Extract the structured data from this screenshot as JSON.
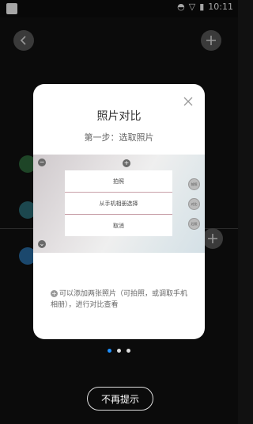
{
  "status_bar": {
    "time": "10:11"
  },
  "dialog": {
    "title": "照片对比",
    "subtitle": "第一步：选取照片",
    "preview_menu": [
      "拍照",
      "从手机相册选择",
      "取消"
    ],
    "preview_side_labels": [
      "前照",
      "对比",
      "后照"
    ],
    "hint": "可以添加两张照片（可拍照，或调取手机相册），进行对比查看"
  },
  "pager": {
    "total": 3,
    "active": 0
  },
  "bottom_button": {
    "label": "不再提示"
  },
  "colors": {
    "accent": "#1e90ff",
    "dialog_bg": "#ffffff",
    "overlay": "#000000"
  },
  "icons": [
    "back-arrow-icon",
    "add-icon",
    "close-icon",
    "plus-circle-icon"
  ]
}
